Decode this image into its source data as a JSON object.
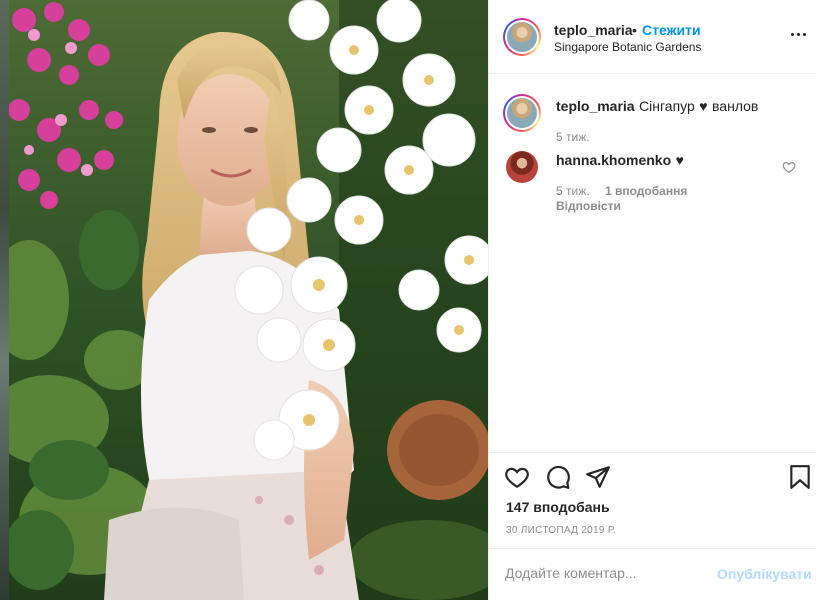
{
  "post": {
    "author": "teplo_maria",
    "follow_label": "Стежити",
    "dot_separator": "•",
    "location": "Singapore Botanic Gardens",
    "more_icon": "more-options-icon"
  },
  "caption": {
    "author": "teplo_maria",
    "text_before": "Сінгапур",
    "heart": "♥",
    "text_after": "ванлов",
    "age": "5 тиж."
  },
  "comments": [
    {
      "author": "hanna.khomenko",
      "heart": "♥",
      "age": "5 тиж.",
      "likes": "1 вподобання",
      "reply_label": "Відповісти"
    }
  ],
  "actions": {
    "likes_count": "147 вподобань",
    "date": "30 ЛИСТОПАД 2019 Р."
  },
  "comment_box": {
    "placeholder": "Додайте коментар...",
    "post_label": "Опублікувати"
  },
  "colors": {
    "link_blue": "#0095f6",
    "post_disabled": "#b3dbff",
    "muted": "#8e8e8e",
    "text": "#262626"
  }
}
